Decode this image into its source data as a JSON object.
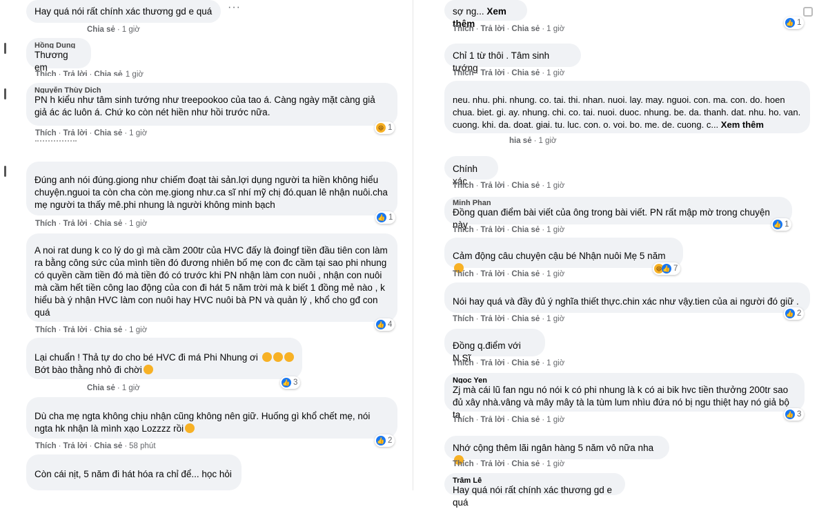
{
  "left": {
    "c1": {
      "text": "Hay quá nói rất chính xác thương gd e quá",
      "share": "Chia sẻ",
      "time": "1 giờ"
    },
    "c2": {
      "name": "Hồng Dung",
      "text": "Thương em",
      "like": "Thích",
      "reply": "Trả lời",
      "share": "Chia sẻ",
      "time": "1 giờ"
    },
    "c3": {
      "name": "Nguyễn Thùy Dịch",
      "text": "PN h kiểu như tâm sinh tướng như treepookoo của tao á. Càng ngày mặt càng giả giả ác ác luôn á. Chứ ko còn nét hiền như hồi trước nữa.",
      "like": "Thích",
      "reply": "Trả lời",
      "share": "Chia sẻ",
      "time": "1 giờ",
      "reactions": "1"
    },
    "c4": {
      "text": "Đúng anh nói đúng.giong như chiếm đoạt tài sản.lợi dụng người ta hiền không hiểu chuyện.nguoi ta còn cha còn mẹ.giong như.ca sĩ nhí mỹ chị đó.quan lê nhận nuôi.cha mẹ người ta thấy mê.phi nhung là người không minh bạch",
      "like": "Thích",
      "reply": "Trả lời",
      "share": "Chia sẻ",
      "time": "1 giờ",
      "reactions": "1"
    },
    "c5": {
      "text": "A noi rat dung k co lý do gì mà cầm 200tr của HVC đấy là đoingf tiền đầu tiên con làm ra bằng công sức của mình tiền đó đương nhiên bố mẹ con đc cầm tại sao phi nhung có quyền cầm tiền đó mà tiền đó có trước khi PN nhận làm con nuôi , nhận con nuôi mà cầm hết tiền công lao động của con đi hát 5 năm trời mà k biết 1 đồng mẻ nào , k hiểu bà ý nhận HVC làm con nuôi hay HVC nuôi bà PN và quản lý , khổ cho gđ con quá",
      "like": "Thích",
      "reply": "Trả lời",
      "share": "Chia sẻ",
      "time": "1 giờ",
      "reactions": "4"
    },
    "c6": {
      "text1": "Lại chuẩn ! Thả tự do cho bé HVC đi má Phi Nhung ơi",
      "text2": "Bớt bào thằng nhỏ đi chời",
      "share": "Chia sẻ",
      "time": "1 giờ",
      "reactions": "3"
    },
    "c7": {
      "text": "Dù cha mẹ ngta không chịu nhận cũng không nên giữ. Huống gì khổ chết mẹ, nói ngta hk nhận là mình xạo Lozzzz rồi",
      "like": "Thích",
      "reply": "Trả lời",
      "share": "Chia sẻ",
      "time": "58 phút",
      "reactions": "2"
    },
    "c8": {
      "text": "Còn cái nịt, 5 năm đi hát hóa ra chỉ để... học hỏi"
    }
  },
  "right": {
    "r1": {
      "text": "sợ ng...",
      "more": "Xem thêm",
      "like": "Thích",
      "reply": "Trả lời",
      "share": "Chia sẻ",
      "time": "1 giờ",
      "reactions": "1"
    },
    "r2": {
      "text": "Chỉ 1 từ thôi . Tâm sinh tướng",
      "like": "Thích",
      "reply": "Trả lời",
      "share": "Chia sẻ",
      "time": "1 giờ"
    },
    "r3": {
      "text": "neu. nhu. phi. nhung. co. tai. thi. nhan. nuoi. lay. may. nguoi. con. ma. con. do. hoen chua. biet. gi. ay. nhung. chi. co. tai. nuoi. duoc. nhung. be. da. thanh. dat. nhu. ho. van. cuong. khi. da. doat. giai. tu. luc. con. o. voi. bo. me. de. cuong. c...",
      "more": "Xem thêm",
      "share": "hia sẻ",
      "time": "1 giờ"
    },
    "r4": {
      "text": "Chính xác",
      "like": "Thích",
      "reply": "Trả lời",
      "share": "Chia sẻ",
      "time": "1 giờ"
    },
    "r5": {
      "name": "Minh Phan",
      "text": "Đồng quan điểm bài viết của ông trong bài viết. PN rất mập mờ trong chuyện này",
      "like": "Thích",
      "reply": "Trả lời",
      "share": "Chia sẻ",
      "time": "1 giờ",
      "reactions": "1"
    },
    "r6": {
      "text": "Cảm động câu chuyện cậu bé Nhận nuôi Mẹ 5 năm",
      "like": "Thích",
      "reply": "Trả lời",
      "share": "Chia sẻ",
      "time": "1 giờ",
      "reactions": "7"
    },
    "r7": {
      "text": "Nói hay quá và đầy đủ ý nghĩa thiết thực.chin xác như vậy.tien của ai người đó giữ .",
      "like": "Thích",
      "reply": "Trả lời",
      "share": "Chia sẻ",
      "time": "1 giờ",
      "reactions": "2"
    },
    "r8": {
      "text": "Đồng q.điểm với N.Sĩ",
      "like": "Thích",
      "reply": "Trả lời",
      "share": "Chia sẻ",
      "time": "1 giờ"
    },
    "r9": {
      "name": "Ngọc Yen",
      "text": "Zj mà cái lũ fan ngu nó nói k có phi nhung là k có ai bik hvc tiền thưởng 200tr sao đủ xây nhà.vâng và mây mây tà la tùm lum nhìu đứa nó bị ngu thiệt hay nó giả bộ ta",
      "like": "Thích",
      "reply": "Trả lời",
      "share": "Chia sẻ",
      "time": "1 giờ",
      "reactions": "3"
    },
    "r10": {
      "text": "Nhớ cộng thêm lãi ngân hàng 5 năm vô nữa nha",
      "like": "Thích",
      "reply": "Trả lời",
      "share": "Chia sẻ",
      "time": "1 giờ"
    },
    "r11": {
      "name": "Trâm Lê",
      "text": "Hay quá nói rất chính xác thương gd e quá"
    }
  }
}
